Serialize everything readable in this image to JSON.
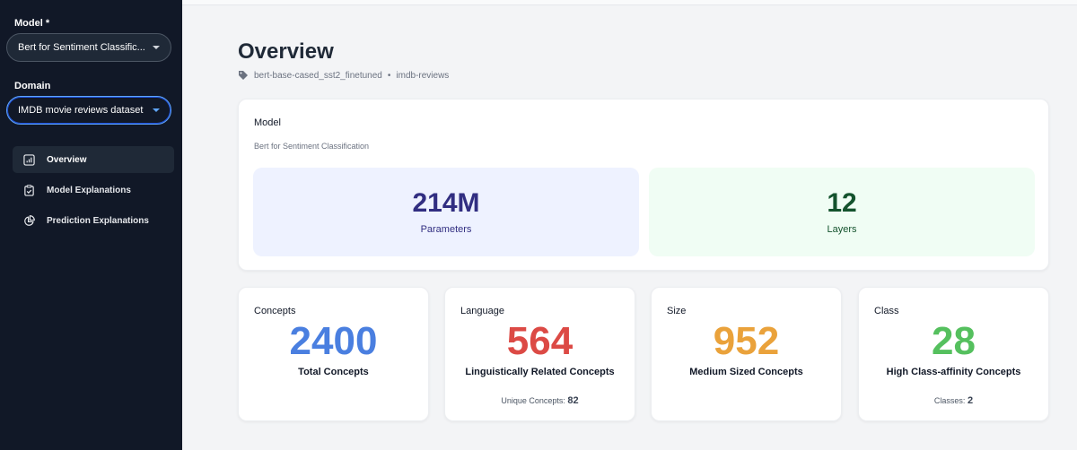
{
  "sidebar": {
    "model_label": "Model *",
    "model_value": "Bert for Sentiment Classific...",
    "domain_label": "Domain",
    "domain_value": "IMDB movie reviews dataset",
    "nav": [
      {
        "label": "Overview",
        "icon": "bar-chart-icon",
        "active": true
      },
      {
        "label": "Model Explanations",
        "icon": "clipboard-check-icon",
        "active": false
      },
      {
        "label": "Prediction Explanations",
        "icon": "pie-chart-icon",
        "active": false
      }
    ]
  },
  "header": {
    "title": "Overview",
    "model_tag": "bert-base-cased_sst2_finetuned",
    "separator": "•",
    "dataset_tag": "imdb-reviews"
  },
  "model_card": {
    "label": "Model",
    "name": "Bert for Sentiment Classification",
    "parameters_value": "214M",
    "parameters_label": "Parameters",
    "layers_value": "12",
    "layers_label": "Layers"
  },
  "concept_cards": [
    {
      "label": "Concepts",
      "value": "2400",
      "desc": "Total Concepts",
      "extra_label": "",
      "extra_value": "",
      "color": "#4a7fe0"
    },
    {
      "label": "Language",
      "value": "564",
      "desc": "Linguistically Related Concepts",
      "extra_label": "Unique Concepts:",
      "extra_value": "82",
      "color": "#dc4a45"
    },
    {
      "label": "Size",
      "value": "952",
      "desc": "Medium Sized Concepts",
      "extra_label": "",
      "extra_value": "",
      "color": "#eaa23b"
    },
    {
      "label": "Class",
      "value": "28",
      "desc": "High Class-affinity Concepts",
      "extra_label": "Classes:",
      "extra_value": "2",
      "color": "#55c05e"
    }
  ],
  "colors": {
    "sidebar_bg": "#111827",
    "accent_blue": "#60a5fa",
    "params_bg": "#eef2ff",
    "layers_bg": "#f0fdf4"
  }
}
